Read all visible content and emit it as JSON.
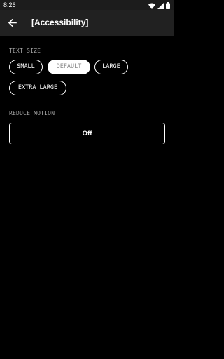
{
  "status_bar": {
    "time": "8:26",
    "icons": [
      "wifi-icon",
      "signal-icon",
      "battery-icon"
    ]
  },
  "app_bar": {
    "back_icon": "arrow-back-icon",
    "title": "[Accessibility]"
  },
  "text_size": {
    "label": "TEXT SIZE",
    "options": [
      {
        "label": "SMALL",
        "selected": false
      },
      {
        "label": "DEFAULT",
        "selected": true
      },
      {
        "label": "LARGE",
        "selected": false
      },
      {
        "label": "EXTRA LARGE",
        "selected": false
      }
    ]
  },
  "reduce_motion": {
    "label": "REDUCE MOTION",
    "value": "Off"
  },
  "colors": {
    "background": "#000000",
    "app_bar": "#212121",
    "status_bar": "#1c1c1c",
    "label": "#a8a8a8",
    "selected_chip_bg": "#ffffff",
    "selected_chip_text": "#8a8a8a"
  }
}
